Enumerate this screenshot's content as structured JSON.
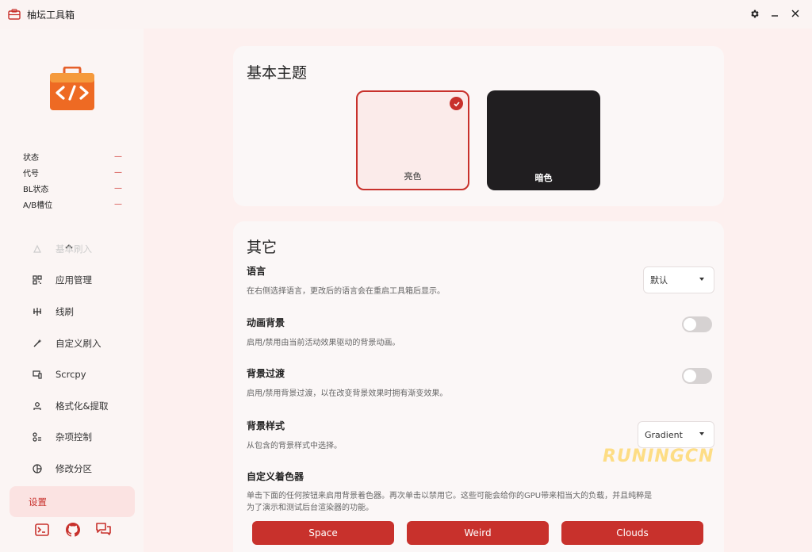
{
  "window": {
    "title": "柚坛工具箱"
  },
  "sidebar": {
    "device_info": [
      {
        "label": "状态",
        "value": "—"
      },
      {
        "label": "代号",
        "value": "—"
      },
      {
        "label": "BL状态",
        "value": "—"
      },
      {
        "label": "A/B槽位",
        "value": "—"
      }
    ],
    "nav": [
      {
        "label": "基本刷入",
        "icon": "flash-icon"
      },
      {
        "label": "应用管理",
        "icon": "apps-icon"
      },
      {
        "label": "线刷",
        "icon": "cable-icon"
      },
      {
        "label": "自定义刷入",
        "icon": "wand-icon"
      },
      {
        "label": "Scrcpy",
        "icon": "screen-mirror-icon"
      },
      {
        "label": "格式化&提取",
        "icon": "format-icon"
      },
      {
        "label": "杂项控制",
        "icon": "misc-control-icon"
      },
      {
        "label": "修改分区",
        "icon": "partition-icon"
      },
      {
        "label": "设置",
        "icon": "settings-icon"
      }
    ],
    "active_nav": "设置"
  },
  "theme": {
    "title": "基本主题",
    "light_label": "亮色",
    "dark_label": "暗色",
    "selected": "亮色"
  },
  "other": {
    "title": "其它",
    "language": {
      "title": "语言",
      "desc": "在右侧选择语言，更改后的语言会在重启工具箱后显示。",
      "value": "默认"
    },
    "animated_bg": {
      "title": "动画背景",
      "desc": "启用/禁用由当前活动效果驱动的背景动画。",
      "enabled": false
    },
    "bg_transition": {
      "title": "背景过渡",
      "desc": "启用/禁用背景过渡，以在改变背景效果时拥有渐变效果。",
      "enabled": false
    },
    "bg_style": {
      "title": "背景样式",
      "desc": "从包含的背景样式中选择。",
      "value": "Gradient"
    },
    "custom_shader": {
      "title": "自定义着色器",
      "desc": "单击下面的任何按钮来启用背景着色器。再次单击以禁用它。这些可能会给你的GPU带来相当大的负载，并且纯粹是为了演示和测试后台渲染器的功能。",
      "buttons": [
        "Space",
        "Weird",
        "Clouds"
      ]
    }
  },
  "watermark": "RUNINGCN",
  "colors": {
    "accent": "#c8312c",
    "background": "#fdf0ef",
    "card": "#fbf7f7",
    "dark_tile": "#201e20"
  }
}
